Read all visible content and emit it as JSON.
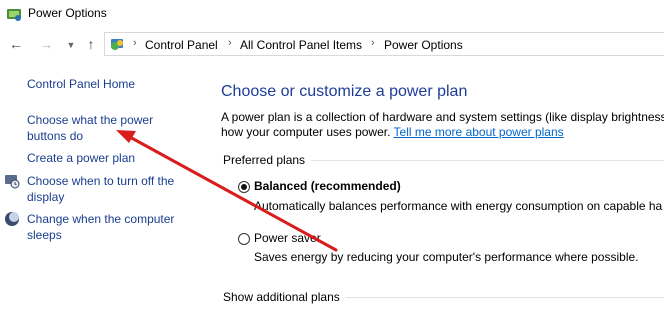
{
  "window": {
    "title": "Power Options"
  },
  "nav": {
    "back_icon": "arrow-left-icon",
    "forward_icon": "arrow-right-icon",
    "recent_icon": "chevron-down-icon",
    "up_icon": "arrow-up-icon"
  },
  "breadcrumb": [
    "Control Panel",
    "All Control Panel Items",
    "Power Options"
  ],
  "sidebar": {
    "items": [
      {
        "label": "Control Panel Home"
      },
      {
        "label_line1": "Choose what the power",
        "label_line2": "buttons do"
      },
      {
        "label": "Create a power plan"
      },
      {
        "label_line1": "Choose when to turn off the",
        "label_line2": "display",
        "icon": "display-off-icon"
      },
      {
        "label_line1": "Change when the computer",
        "label_line2": "sleeps",
        "icon": "sleep-moon-icon"
      }
    ]
  },
  "main": {
    "title": "Choose or customize a power plan",
    "description_line1": "A power plan is a collection of hardware and system settings (like display brightness,",
    "description_line2": "how your computer uses power.",
    "learn_more": "Tell me more about power plans",
    "preferred_label": "Preferred plans",
    "plans": [
      {
        "name": "Balanced (recommended)",
        "selected": true,
        "description": "Automatically balances performance with energy consumption on capable ha"
      },
      {
        "name": "Power saver",
        "selected": false,
        "description": "Saves energy by reducing your computer's performance where possible."
      }
    ],
    "additional_label": "Show additional plans"
  },
  "annotation": {
    "color": "#d91c1c",
    "icon": "red-arrow-annotation"
  }
}
